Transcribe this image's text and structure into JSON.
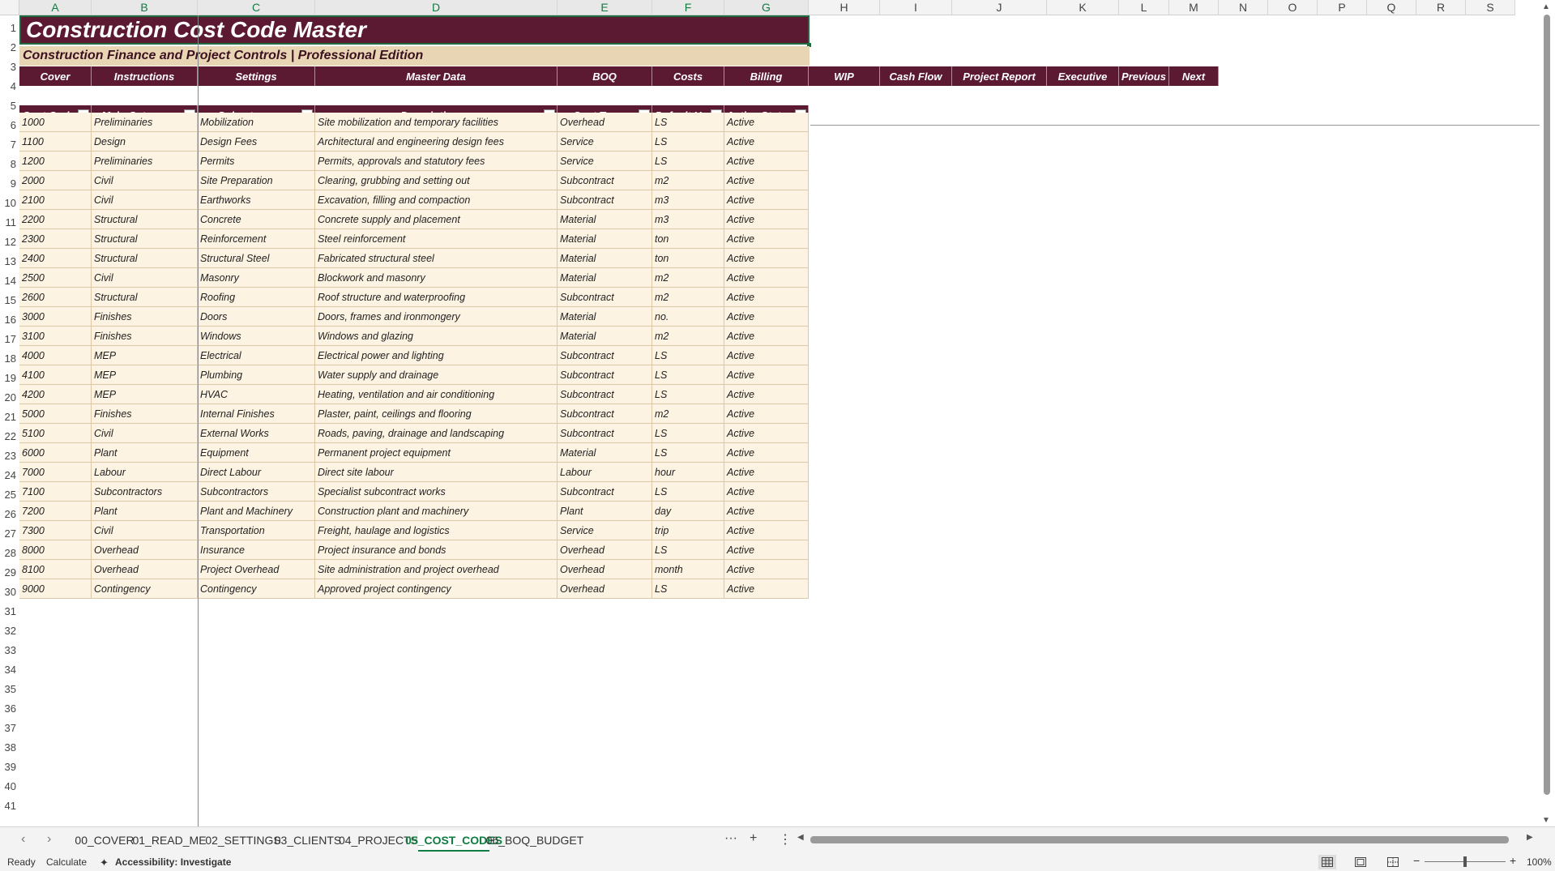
{
  "columns": [
    "A",
    "B",
    "C",
    "D",
    "E",
    "F",
    "G",
    "H",
    "I",
    "J",
    "K",
    "L",
    "M",
    "N",
    "O",
    "P",
    "Q",
    "R",
    "S"
  ],
  "rows": [
    "1",
    "2",
    "3",
    "4",
    "5",
    "6",
    "7",
    "8",
    "9",
    "10",
    "11",
    "12",
    "13",
    "14",
    "15",
    "16",
    "17",
    "18",
    "19",
    "20",
    "21",
    "22",
    "23",
    "24",
    "25",
    "26",
    "27",
    "28",
    "29",
    "30",
    "31",
    "32",
    "33",
    "34",
    "35",
    "36",
    "37",
    "38",
    "39",
    "40",
    "41"
  ],
  "sheet": {
    "title": "Construction Cost Code Master",
    "subtitle": "Construction Finance and Project Controls | Professional Edition",
    "nav": [
      "Cover",
      "Instructions",
      "Settings",
      "Master Data",
      "BOQ",
      "Costs",
      "Billing",
      "WIP",
      "Cash Flow",
      "Project Report",
      "Executive",
      "Previous",
      "Next"
    ],
    "headers": [
      "Cost Code",
      "Main Category",
      "Subcategory",
      "Description",
      "Cost Type",
      "Default Un",
      "Active Status"
    ],
    "records": [
      [
        "1000",
        "Preliminaries",
        "Mobilization",
        "Site mobilization and temporary facilities",
        "Overhead",
        "LS",
        "Active"
      ],
      [
        "1100",
        "Design",
        "Design Fees",
        "Architectural and engineering design fees",
        "Service",
        "LS",
        "Active"
      ],
      [
        "1200",
        "Preliminaries",
        "Permits",
        "Permits, approvals and statutory fees",
        "Service",
        "LS",
        "Active"
      ],
      [
        "2000",
        "Civil",
        "Site Preparation",
        "Clearing, grubbing and setting out",
        "Subcontract",
        "m2",
        "Active"
      ],
      [
        "2100",
        "Civil",
        "Earthworks",
        "Excavation, filling and compaction",
        "Subcontract",
        "m3",
        "Active"
      ],
      [
        "2200",
        "Structural",
        "Concrete",
        "Concrete supply and placement",
        "Material",
        "m3",
        "Active"
      ],
      [
        "2300",
        "Structural",
        "Reinforcement",
        "Steel reinforcement",
        "Material",
        "ton",
        "Active"
      ],
      [
        "2400",
        "Structural",
        "Structural Steel",
        "Fabricated structural steel",
        "Material",
        "ton",
        "Active"
      ],
      [
        "2500",
        "Civil",
        "Masonry",
        "Blockwork and masonry",
        "Material",
        "m2",
        "Active"
      ],
      [
        "2600",
        "Structural",
        "Roofing",
        "Roof structure and waterproofing",
        "Subcontract",
        "m2",
        "Active"
      ],
      [
        "3000",
        "Finishes",
        "Doors",
        "Doors, frames and ironmongery",
        "Material",
        "no.",
        "Active"
      ],
      [
        "3100",
        "Finishes",
        "Windows",
        "Windows and glazing",
        "Material",
        "m2",
        "Active"
      ],
      [
        "4000",
        "MEP",
        "Electrical",
        "Electrical power and lighting",
        "Subcontract",
        "LS",
        "Active"
      ],
      [
        "4100",
        "MEP",
        "Plumbing",
        "Water supply and drainage",
        "Subcontract",
        "LS",
        "Active"
      ],
      [
        "4200",
        "MEP",
        "HVAC",
        "Heating, ventilation and air conditioning",
        "Subcontract",
        "LS",
        "Active"
      ],
      [
        "5000",
        "Finishes",
        "Internal Finishes",
        "Plaster, paint, ceilings and flooring",
        "Subcontract",
        "m2",
        "Active"
      ],
      [
        "5100",
        "Civil",
        "External Works",
        "Roads, paving, drainage and landscaping",
        "Subcontract",
        "LS",
        "Active"
      ],
      [
        "6000",
        "Plant",
        "Equipment",
        "Permanent project equipment",
        "Material",
        "LS",
        "Active"
      ],
      [
        "7000",
        "Labour",
        "Direct Labour",
        "Direct site labour",
        "Labour",
        "hour",
        "Active"
      ],
      [
        "7100",
        "Subcontractors",
        "Subcontractors",
        "Specialist subcontract works",
        "Subcontract",
        "LS",
        "Active"
      ],
      [
        "7200",
        "Plant",
        "Plant and Machinery",
        "Construction plant and machinery",
        "Plant",
        "day",
        "Active"
      ],
      [
        "7300",
        "Civil",
        "Transportation",
        "Freight, haulage and logistics",
        "Service",
        "trip",
        "Active"
      ],
      [
        "8000",
        "Overhead",
        "Insurance",
        "Project insurance and bonds",
        "Overhead",
        "LS",
        "Active"
      ],
      [
        "8100",
        "Overhead",
        "Project Overhead",
        "Site administration and project overhead",
        "Overhead",
        "month",
        "Active"
      ],
      [
        "9000",
        "Contingency",
        "Contingency",
        "Approved project contingency",
        "Overhead",
        "LS",
        "Active"
      ]
    ]
  },
  "tabs": [
    "00_COVER",
    "01_READ_ME",
    "02_SETTINGS",
    "03_CLIENTS",
    "04_PROJECTS",
    "05_COST_CODES",
    "06_BOQ_BUDGET"
  ],
  "active_tab": "05_COST_CODES",
  "tab_more": "···",
  "tab_add": "+",
  "status": {
    "ready": "Ready",
    "calculate": "Calculate",
    "accessibility": "Accessibility: Investigate",
    "zoom": "100%"
  },
  "colors": {
    "header_fill": "#5b1a32",
    "subtitle_fill": "#e8d5b3",
    "row_fill": "#fdf3e2",
    "accent": "#107c41"
  }
}
